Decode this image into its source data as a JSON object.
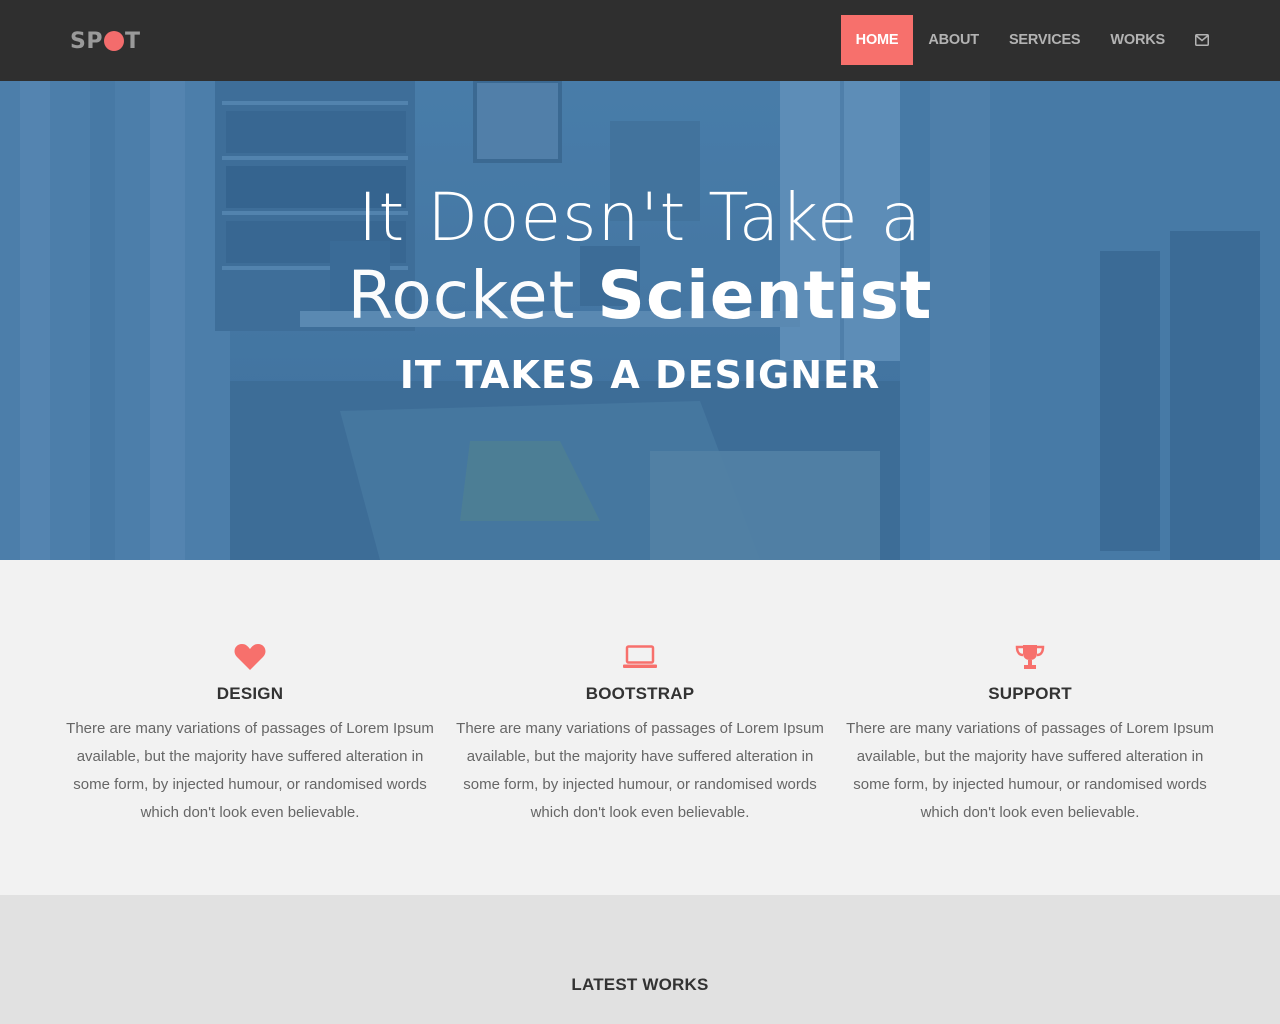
{
  "brand": {
    "logo_left": "SP",
    "logo_right": "T"
  },
  "nav": {
    "items": [
      {
        "label": "HOME",
        "active": true
      },
      {
        "label": "ABOUT"
      },
      {
        "label": "SERVICES"
      },
      {
        "label": "WORKS"
      }
    ],
    "contact_icon": "envelope-icon"
  },
  "hero": {
    "line1": "It Doesn't Take a",
    "line2_thin": "Rocket",
    "line2_bold": "Scientist",
    "subtitle": "IT TAKES A DESIGNER"
  },
  "features": [
    {
      "icon": "heart-icon",
      "title": "DESIGN",
      "text": "There are many variations of passages of Lorem Ipsum available, but the majority have suffered alteration in some form, by injected humour, or randomised words which don't look even believable."
    },
    {
      "icon": "laptop-icon",
      "title": "BOOTSTRAP",
      "text": "There are many variations of passages of Lorem Ipsum available, but the majority have suffered alteration in some form, by injected humour, or randomised words which don't look even believable."
    },
    {
      "icon": "trophy-icon",
      "title": "SUPPORT",
      "text": "There are many variations of passages of Lorem Ipsum available, but the majority have suffered alteration in some form, by injected humour, or randomised words which don't look even believable."
    }
  ],
  "works": {
    "title": "LATEST WORKS"
  },
  "colors": {
    "accent": "#f7706c",
    "navbar": "#2f2f2f",
    "hero_overlay": "#4a7aa2"
  }
}
